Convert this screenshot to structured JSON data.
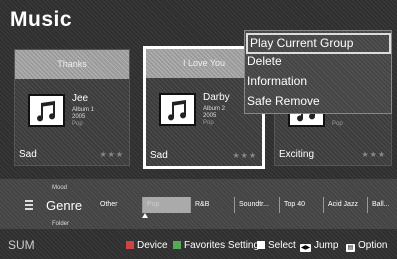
{
  "title": "Music",
  "cards": [
    {
      "header": "Thanks",
      "artist": "Jee",
      "album": "Album 1",
      "year": "2005",
      "extra": "Pop",
      "mood": "Sad",
      "stars": "★★★"
    },
    {
      "header": "I Love You",
      "artist": "Darby",
      "album": "Album 2",
      "year": "2005",
      "extra": "Pop",
      "mood": "Sad",
      "stars": "★★★"
    },
    {
      "header": "",
      "artist": "",
      "album": "",
      "year": "",
      "extra": "Pop",
      "mood": "Exciting",
      "stars": "★★★"
    }
  ],
  "menu": {
    "items": [
      "Play Current Group",
      "Delete",
      "Information",
      "Safe Remove"
    ]
  },
  "category": {
    "above": "Mood",
    "current": "Genre",
    "below": "Folder"
  },
  "filters": [
    "Other",
    "Pop",
    "R&B",
    "Soundtr...",
    "Top 40",
    "Acid Jazz",
    "Ball..."
  ],
  "bottom": {
    "device_label": "SUM",
    "device": "Device",
    "favorites": "Favorites Setting",
    "select": "Select",
    "jump": "Jump",
    "option": "Option"
  },
  "colors": {
    "red_button": "#c44",
    "green_button": "#5a5"
  }
}
